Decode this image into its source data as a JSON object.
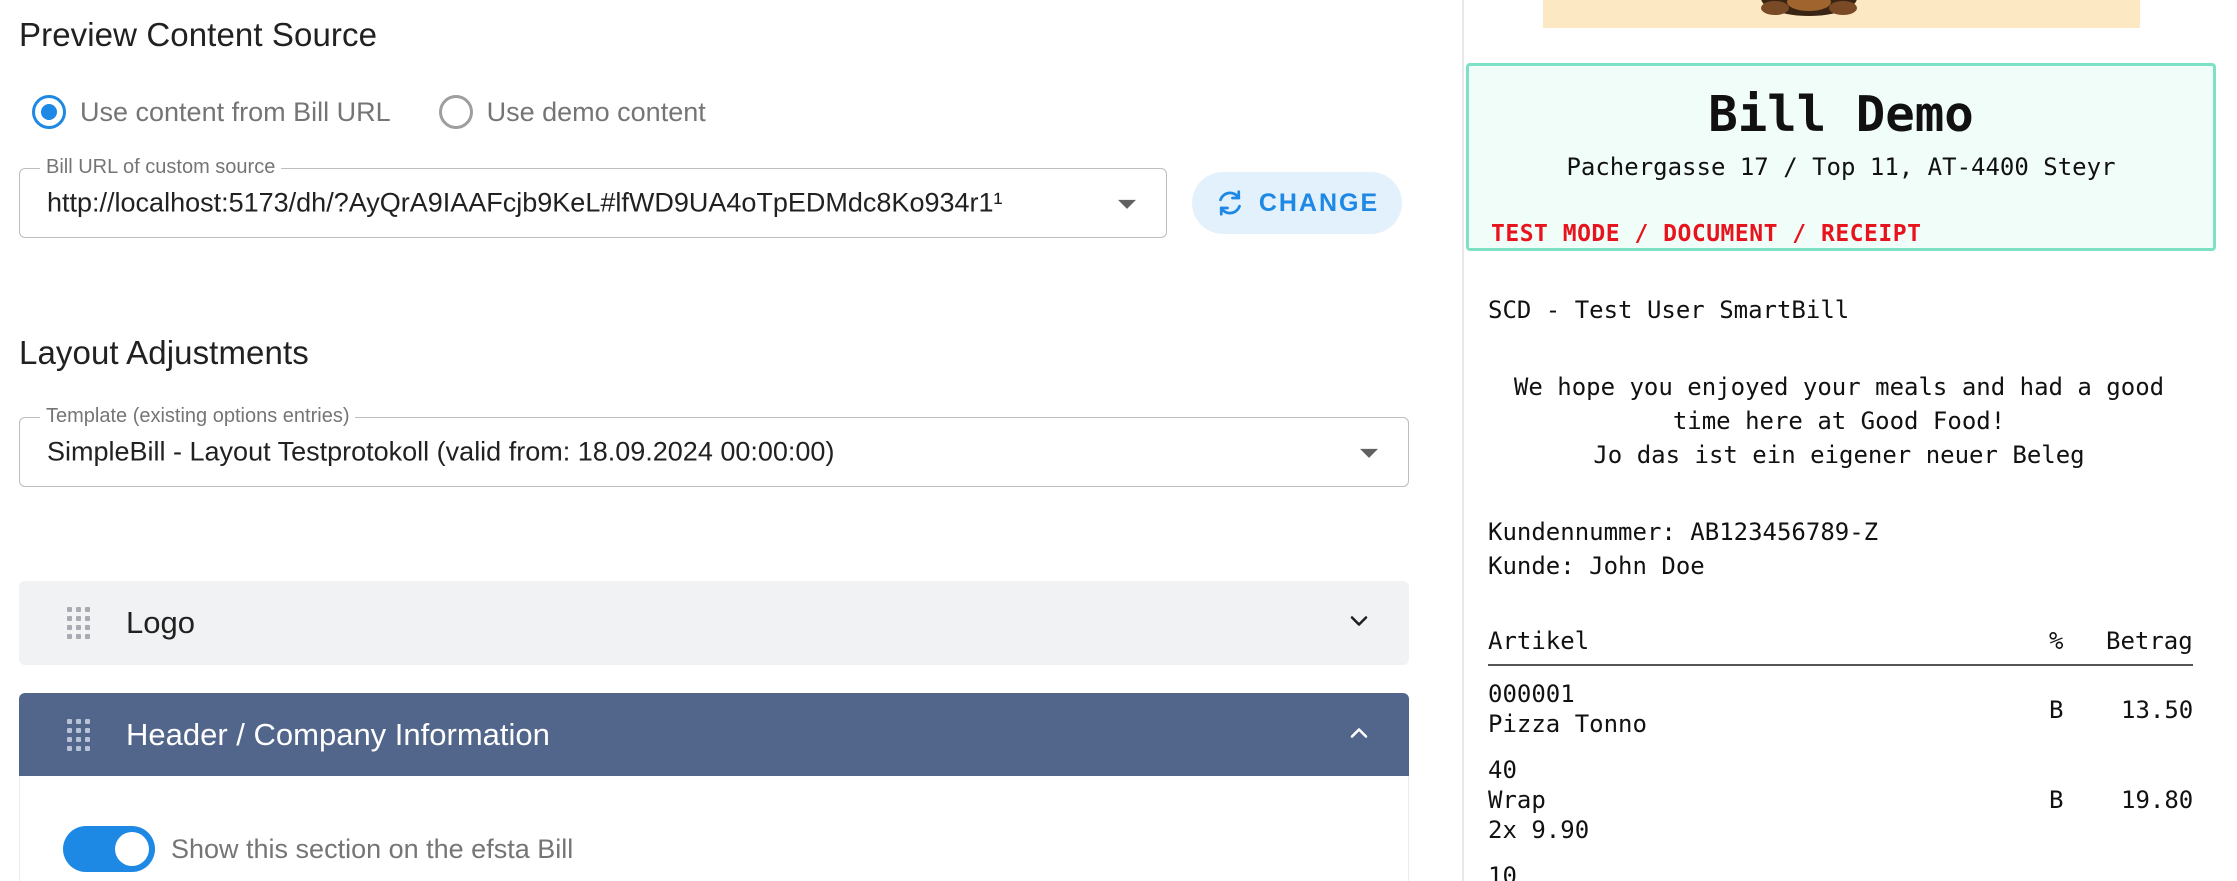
{
  "preview_source": {
    "title": "Preview Content Source",
    "radio_options": [
      {
        "label": "Use content from Bill URL",
        "checked": true
      },
      {
        "label": "Use demo content",
        "checked": false
      }
    ],
    "url_field": {
      "label": "Bill URL of custom source",
      "value": "http://localhost:5173/dh/?AyQrA9IAAFcjb9KeL#lfWD9UA4oTpEDMdc8Ko934r1¹"
    },
    "change_button": {
      "label": "CHANGE",
      "icon": "refresh-icon"
    }
  },
  "layout_adjustments": {
    "title": "Layout Adjustments",
    "template_field": {
      "label": "Template (existing options entries)",
      "value": "SimpleBill - Layout Testprotokoll (valid from: 18.09.2024 00:00:00)"
    },
    "sections": [
      {
        "title": "Logo",
        "expanded": false,
        "icon": "chevron-down-icon"
      },
      {
        "title": "Header / Company Information",
        "expanded": true,
        "icon": "chevron-up-icon"
      }
    ],
    "show_section_toggle": {
      "label": "Show this section on the efsta Bill",
      "on": true
    }
  },
  "colors": {
    "accent": "#1e88e5",
    "panel_header": "#52658b",
    "test_mode_red": "#e8141d",
    "header_box_border": "#7ee0c4"
  },
  "receipt": {
    "title": "Bill Demo",
    "address": "Pachergasse 17 / Top 11, AT-4400 Steyr",
    "test_mode": "TEST MODE / DOCUMENT / RECEIPT",
    "scd": "SCD - Test User SmartBill",
    "greeting_lines": [
      "We hope you enjoyed your meals and had a good",
      "time here at Good Food!",
      "Jo das ist ein eigener neuer Beleg"
    ],
    "customer_number": "Kundennummer: AB123456789-Z",
    "customer": "Kunde: John Doe",
    "columns": {
      "item": "Artikel",
      "tax": "%",
      "amount": "Betrag"
    },
    "items": [
      {
        "code": "000001",
        "name": "Pizza Tonno",
        "qty_line": "",
        "tax": "B",
        "amount": "13.50"
      },
      {
        "code": "40",
        "name": "Wrap",
        "qty_line": "2x 9.90",
        "tax": "B",
        "amount": "19.80"
      },
      {
        "code": "10",
        "name": "",
        "qty_line": "",
        "tax": "",
        "amount": ""
      }
    ]
  }
}
